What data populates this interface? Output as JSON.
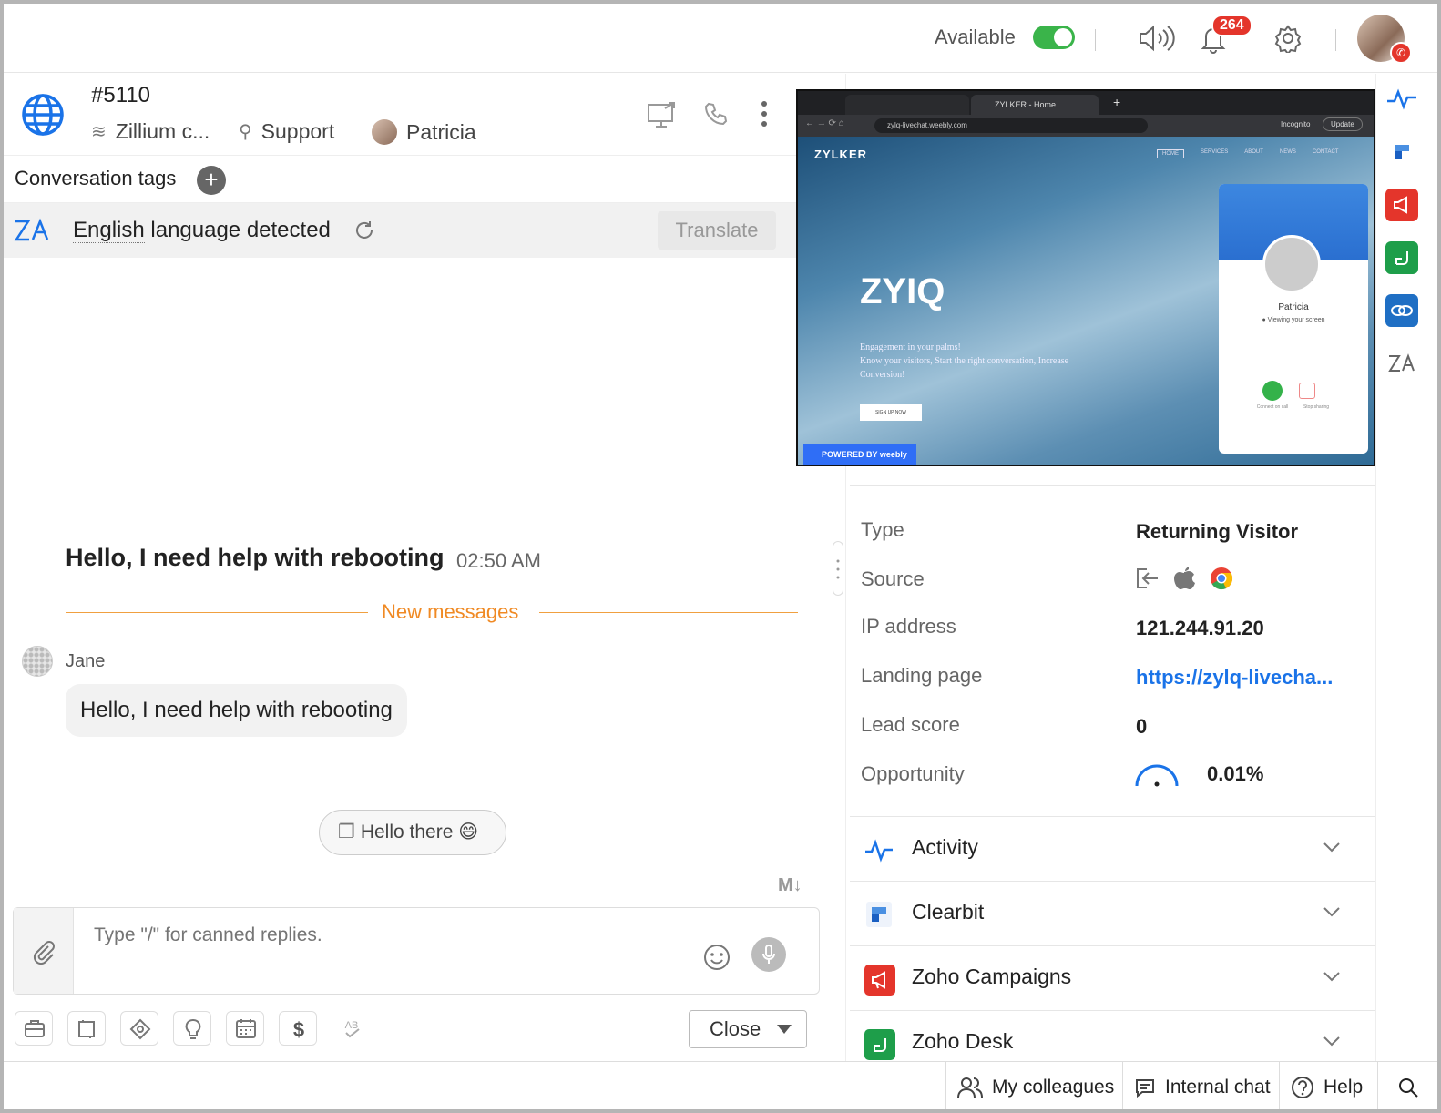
{
  "topbar": {
    "availability_label": "Available",
    "notification_count": "264"
  },
  "conversation": {
    "ticket_id": "#5110",
    "department_org": "Zillium c...",
    "department": "Support",
    "agent": "Patricia",
    "tags_label": "Conversation tags",
    "language_name": "English",
    "language_suffix": " language detected",
    "translate_label": "Translate",
    "main_message": "Hello, I need help with rebooting",
    "main_message_time": "02:50 AM",
    "new_messages_label": "New messages",
    "sender_name": "Jane",
    "sender_message": "Hello, I need help with rebooting",
    "quick_reply_chip": "Hello there 😄",
    "markdown_icon_label": "M↓",
    "composer_placeholder": "Type \"/\" for canned replies.",
    "close_label": "Close"
  },
  "shared_screen": {
    "tab_title": "ZYLKER - Home",
    "url": "zylq-livechat.weebly.com",
    "incognito_label": "Incognito",
    "update_label": "Update",
    "brand": "ZYLKER",
    "nav": [
      "HOME",
      "SERVICES",
      "ABOUT",
      "NEWS",
      "CONTACT"
    ],
    "hero_title": "ZYIQ",
    "hero_line1": "Engagement in your palms!",
    "hero_line2": "Know your visitors, Start the right conversation, Increase",
    "hero_line3": "Conversion!",
    "signup_label": "SIGN UP NOW",
    "powered_by": "POWERED BY weebly",
    "widget_name": "Patricia",
    "widget_status": "● Viewing your screen",
    "widget_connect": "Connect on call",
    "widget_stop": "Stop sharing"
  },
  "visitor": {
    "type_label": "Type",
    "type_value": "Returning Visitor",
    "source_label": "Source",
    "ip_label": "IP address",
    "ip_value": "121.244.91.20",
    "landing_label": "Landing page",
    "landing_value": "https://zylq-livecha...",
    "lead_label": "Lead score",
    "lead_value": "0",
    "opportunity_label": "Opportunity",
    "opportunity_value": "0.01%"
  },
  "accordions": [
    {
      "label": "Activity",
      "icon": "activity-icon",
      "color": "#1a73e8"
    },
    {
      "label": "Clearbit",
      "icon": "clearbit-icon",
      "color": "#4a90e2"
    },
    {
      "label": "Zoho Campaigns",
      "icon": "campaigns-icon",
      "color": "#e4352b"
    },
    {
      "label": "Zoho Desk",
      "icon": "desk-icon",
      "color": "#1e9e4a"
    }
  ],
  "bottombar": {
    "colleagues": "My colleagues",
    "internal_chat": "Internal chat",
    "help": "Help"
  },
  "colors": {
    "accent_blue": "#1a73e8",
    "available_green": "#3ab44a",
    "alert_red": "#e4352b",
    "new_messages_orange": "#f08a24"
  }
}
